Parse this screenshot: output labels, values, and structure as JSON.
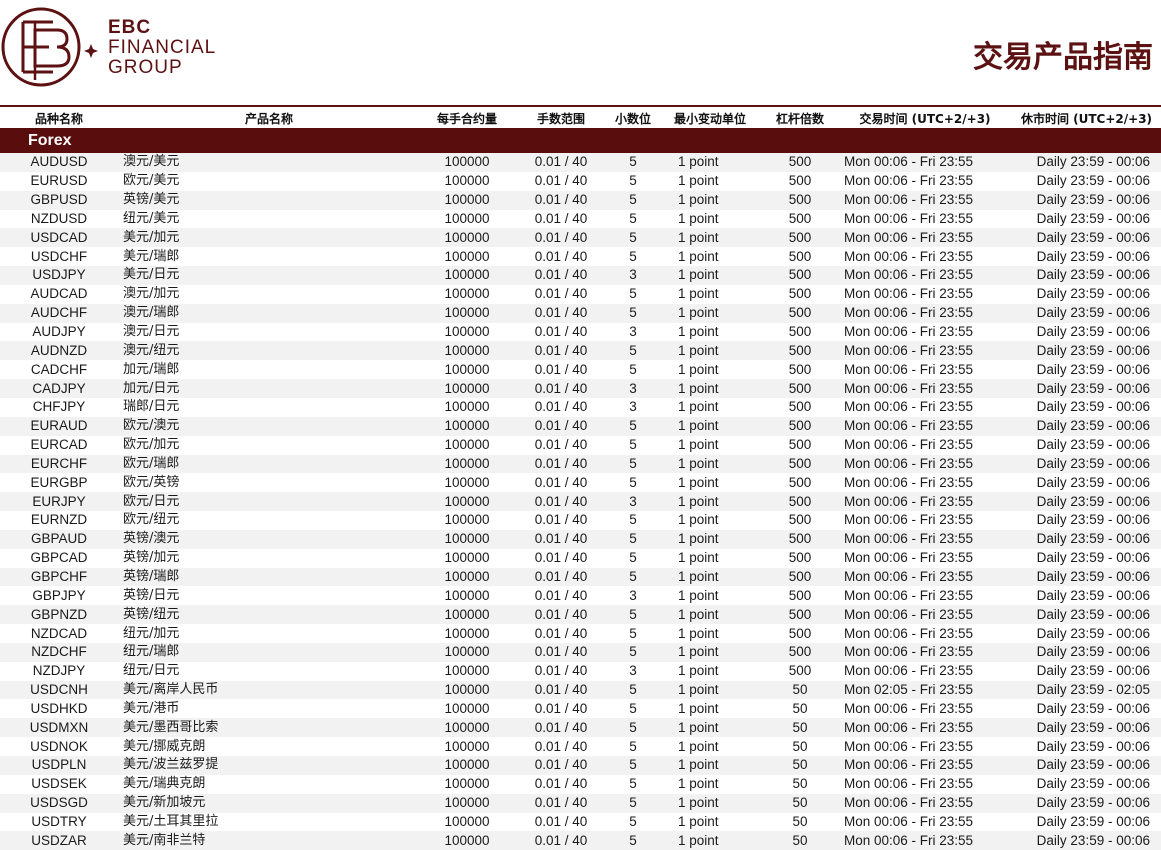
{
  "header": {
    "logo": {
      "line1": "EBC",
      "line2": "FINANCIAL",
      "line3": "GROUP"
    },
    "title": "交易产品指南"
  },
  "colors": {
    "brand": "#5c1212",
    "section_bg": "#5a0d0d",
    "row_alt": "#f2f2f2"
  },
  "table": {
    "columns": [
      "品种名称",
      "产品名称",
      "每手合约量",
      "手数范围",
      "小数位",
      "最小变动单位",
      "杠杆倍数",
      "交易时间 (UTC+2/+3)",
      "休市时间 (UTC+2/+3)"
    ],
    "section": "Forex",
    "rows": [
      [
        "AUDUSD",
        "澳元/美元",
        "100000",
        "0.01 / 40",
        "5",
        "1 point",
        "500",
        "Mon 00:06 - Fri 23:55",
        "Daily 23:59 - 00:06"
      ],
      [
        "EURUSD",
        "欧元/美元",
        "100000",
        "0.01 / 40",
        "5",
        "1 point",
        "500",
        "Mon 00:06 - Fri 23:55",
        "Daily 23:59 - 00:06"
      ],
      [
        "GBPUSD",
        "英镑/美元",
        "100000",
        "0.01 / 40",
        "5",
        "1 point",
        "500",
        "Mon 00:06 - Fri 23:55",
        "Daily 23:59 - 00:06"
      ],
      [
        "NZDUSD",
        "纽元/美元",
        "100000",
        "0.01 / 40",
        "5",
        "1 point",
        "500",
        "Mon 00:06 - Fri 23:55",
        "Daily 23:59 - 00:06"
      ],
      [
        "USDCAD",
        "美元/加元",
        "100000",
        "0.01 / 40",
        "5",
        "1 point",
        "500",
        "Mon 00:06 - Fri 23:55",
        "Daily 23:59 - 00:06"
      ],
      [
        "USDCHF",
        "美元/瑞郎",
        "100000",
        "0.01 / 40",
        "5",
        "1 point",
        "500",
        "Mon 00:06 - Fri 23:55",
        "Daily 23:59 - 00:06"
      ],
      [
        "USDJPY",
        "美元/日元",
        "100000",
        "0.01 / 40",
        "3",
        "1 point",
        "500",
        "Mon 00:06 - Fri 23:55",
        "Daily 23:59 - 00:06"
      ],
      [
        "AUDCAD",
        "澳元/加元",
        "100000",
        "0.01 / 40",
        "5",
        "1 point",
        "500",
        "Mon 00:06 - Fri 23:55",
        "Daily 23:59 - 00:06"
      ],
      [
        "AUDCHF",
        "澳元/瑞郎",
        "100000",
        "0.01 / 40",
        "5",
        "1 point",
        "500",
        "Mon 00:06 - Fri 23:55",
        "Daily 23:59 - 00:06"
      ],
      [
        "AUDJPY",
        "澳元/日元",
        "100000",
        "0.01 / 40",
        "3",
        "1 point",
        "500",
        "Mon 00:06 - Fri 23:55",
        "Daily 23:59 - 00:06"
      ],
      [
        "AUDNZD",
        "澳元/纽元",
        "100000",
        "0.01 / 40",
        "5",
        "1 point",
        "500",
        "Mon 00:06 - Fri 23:55",
        "Daily 23:59 - 00:06"
      ],
      [
        "CADCHF",
        "加元/瑞郎",
        "100000",
        "0.01 / 40",
        "5",
        "1 point",
        "500",
        "Mon 00:06 - Fri 23:55",
        "Daily 23:59 - 00:06"
      ],
      [
        "CADJPY",
        "加元/日元",
        "100000",
        "0.01 / 40",
        "3",
        "1 point",
        "500",
        "Mon 00:06 - Fri 23:55",
        "Daily 23:59 - 00:06"
      ],
      [
        "CHFJPY",
        "瑞郎/日元",
        "100000",
        "0.01 / 40",
        "3",
        "1 point",
        "500",
        "Mon 00:06 - Fri 23:55",
        "Daily 23:59 - 00:06"
      ],
      [
        "EURAUD",
        "欧元/澳元",
        "100000",
        "0.01 / 40",
        "5",
        "1 point",
        "500",
        "Mon 00:06 - Fri 23:55",
        "Daily 23:59 - 00:06"
      ],
      [
        "EURCAD",
        "欧元/加元",
        "100000",
        "0.01 / 40",
        "5",
        "1 point",
        "500",
        "Mon 00:06 - Fri 23:55",
        "Daily 23:59 - 00:06"
      ],
      [
        "EURCHF",
        "欧元/瑞郎",
        "100000",
        "0.01 / 40",
        "5",
        "1 point",
        "500",
        "Mon 00:06 - Fri 23:55",
        "Daily 23:59 - 00:06"
      ],
      [
        "EURGBP",
        "欧元/英镑",
        "100000",
        "0.01 / 40",
        "5",
        "1 point",
        "500",
        "Mon 00:06 - Fri 23:55",
        "Daily 23:59 - 00:06"
      ],
      [
        "EURJPY",
        "欧元/日元",
        "100000",
        "0.01 / 40",
        "3",
        "1 point",
        "500",
        "Mon 00:06 - Fri 23:55",
        "Daily 23:59 - 00:06"
      ],
      [
        "EURNZD",
        "欧元/纽元",
        "100000",
        "0.01 / 40",
        "5",
        "1 point",
        "500",
        "Mon 00:06 - Fri 23:55",
        "Daily 23:59 - 00:06"
      ],
      [
        "GBPAUD",
        "英镑/澳元",
        "100000",
        "0.01 / 40",
        "5",
        "1 point",
        "500",
        "Mon 00:06 - Fri 23:55",
        "Daily 23:59 - 00:06"
      ],
      [
        "GBPCAD",
        "英镑/加元",
        "100000",
        "0.01 / 40",
        "5",
        "1 point",
        "500",
        "Mon 00:06 - Fri 23:55",
        "Daily 23:59 - 00:06"
      ],
      [
        "GBPCHF",
        "英镑/瑞郎",
        "100000",
        "0.01 / 40",
        "5",
        "1 point",
        "500",
        "Mon 00:06 - Fri 23:55",
        "Daily 23:59 - 00:06"
      ],
      [
        "GBPJPY",
        "英镑/日元",
        "100000",
        "0.01 / 40",
        "3",
        "1 point",
        "500",
        "Mon 00:06 - Fri 23:55",
        "Daily 23:59 - 00:06"
      ],
      [
        "GBPNZD",
        "英镑/纽元",
        "100000",
        "0.01 / 40",
        "5",
        "1 point",
        "500",
        "Mon 00:06 - Fri 23:55",
        "Daily 23:59 - 00:06"
      ],
      [
        "NZDCAD",
        "纽元/加元",
        "100000",
        "0.01 / 40",
        "5",
        "1 point",
        "500",
        "Mon 00:06 - Fri 23:55",
        "Daily 23:59 - 00:06"
      ],
      [
        "NZDCHF",
        "纽元/瑞郎",
        "100000",
        "0.01 / 40",
        "5",
        "1 point",
        "500",
        "Mon 00:06 - Fri 23:55",
        "Daily 23:59 - 00:06"
      ],
      [
        "NZDJPY",
        "纽元/日元",
        "100000",
        "0.01 / 40",
        "3",
        "1 point",
        "500",
        "Mon 00:06 - Fri 23:55",
        "Daily 23:59 - 00:06"
      ],
      [
        "USDCNH",
        "美元/离岸人民币",
        "100000",
        "0.01 / 40",
        "5",
        "1 point",
        "50",
        "Mon 02:05 - Fri 23:55",
        "Daily 23:59 - 02:05"
      ],
      [
        "USDHKD",
        "美元/港币",
        "100000",
        "0.01 / 40",
        "5",
        "1 point",
        "50",
        "Mon 00:06 - Fri 23:55",
        "Daily 23:59 - 00:06"
      ],
      [
        "USDMXN",
        "美元/墨西哥比索",
        "100000",
        "0.01 / 40",
        "5",
        "1 point",
        "50",
        "Mon 00:06 - Fri 23:55",
        "Daily 23:59 - 00:06"
      ],
      [
        "USDNOK",
        "美元/挪威克朗",
        "100000",
        "0.01 / 40",
        "5",
        "1 point",
        "50",
        "Mon 00:06 - Fri 23:55",
        "Daily 23:59 - 00:06"
      ],
      [
        "USDPLN",
        "美元/波兰兹罗提",
        "100000",
        "0.01 / 40",
        "5",
        "1 point",
        "50",
        "Mon 00:06 - Fri 23:55",
        "Daily 23:59 - 00:06"
      ],
      [
        "USDSEK",
        "美元/瑞典克朗",
        "100000",
        "0.01 / 40",
        "5",
        "1 point",
        "50",
        "Mon 00:06 - Fri 23:55",
        "Daily 23:59 - 00:06"
      ],
      [
        "USDSGD",
        "美元/新加坡元",
        "100000",
        "0.01 / 40",
        "5",
        "1 point",
        "50",
        "Mon 00:06 - Fri 23:55",
        "Daily 23:59 - 00:06"
      ],
      [
        "USDTRY",
        "美元/土耳其里拉",
        "100000",
        "0.01 / 40",
        "5",
        "1 point",
        "50",
        "Mon 00:06 - Fri 23:55",
        "Daily 23:59 - 00:06"
      ],
      [
        "USDZAR",
        "美元/南非兰特",
        "100000",
        "0.01 / 40",
        "5",
        "1 point",
        "50",
        "Mon 00:06 - Fri 23:55",
        "Daily 23:59 - 00:06"
      ]
    ]
  }
}
